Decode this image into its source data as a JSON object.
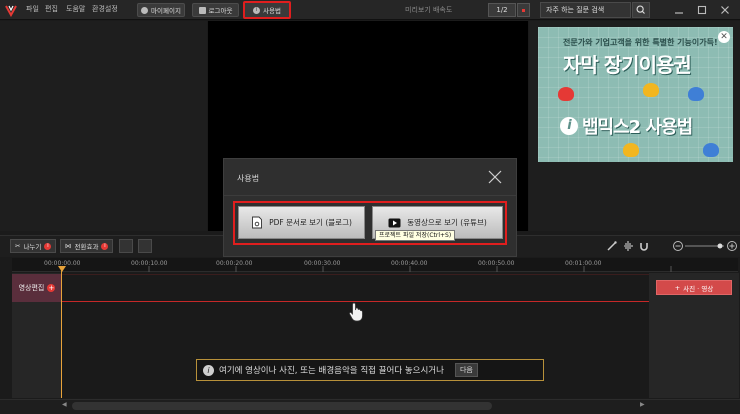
{
  "menu": [
    "파일",
    "편집",
    "도움말",
    "환경설정"
  ],
  "toolbar": {
    "mypage": "마이페이지",
    "logout": "로그아웃",
    "help": "사용법",
    "preview_rate_label": "미리보기 배속도",
    "preview_rate_value": "1/2",
    "faq_text": "자주 하는 질문 검색"
  },
  "ad": {
    "line1": "전문가와 기업고객을 위한 특별한 기능이가득!",
    "line2": "자막 장기이용권",
    "line3": "뱁믹스2 사용법"
  },
  "dialog": {
    "title": "사용법",
    "pdf_button": "PDF 문서로 보기 (블로그)",
    "video_button": "동영상으로 보기 (유튜브)",
    "tooltip": "프로젝트 파일 저장(Ctrl+S)"
  },
  "timeline": {
    "split": "나누기",
    "transition": "전환효과",
    "ticks": [
      "00:00:00.00",
      "00:00:10.00",
      "00:00:20.00",
      "00:00:30.00",
      "00:00:40.00",
      "00:00:50.00",
      "00:01:00.00"
    ],
    "track_label": "영상편집",
    "add_media": "사진 · 영상"
  },
  "hint": {
    "text": "여기에 영상이나 사진, 또는 배경음악을 직접 끌어다 놓으시거나",
    "next": "다음"
  },
  "colors": {
    "accent_red": "#e01e1e",
    "track_head": "#5a2e3c",
    "playhead": "#e8a33a"
  }
}
